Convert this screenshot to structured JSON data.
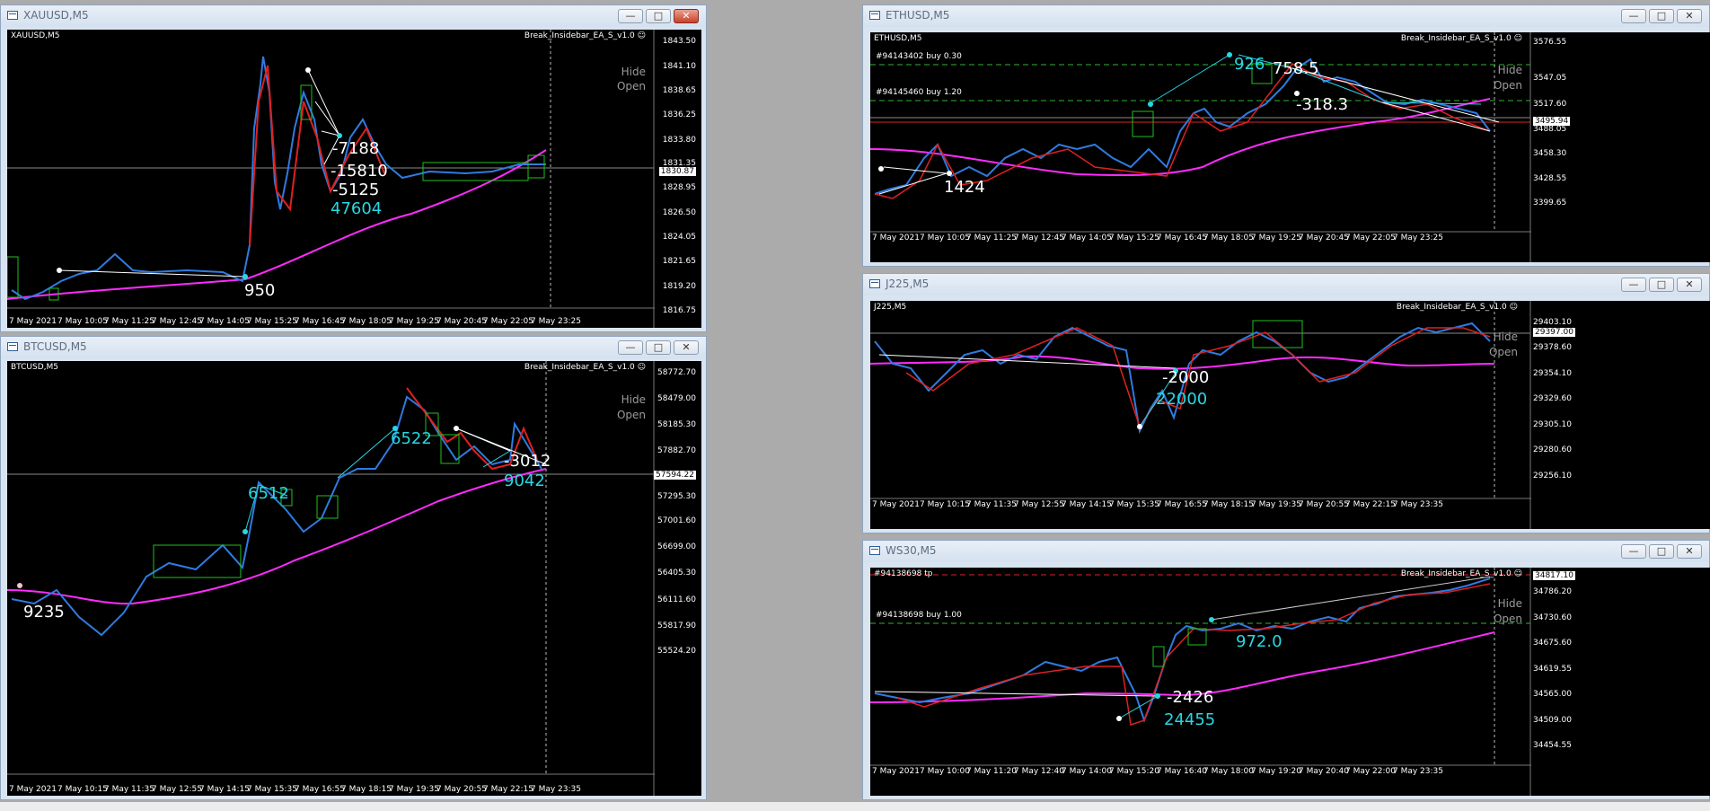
{
  "common": {
    "ea_name": "Break_Insidebar_EA_S_v1.0 ☺",
    "hide_label": "Hide",
    "open_label": "Open"
  },
  "windows": {
    "xau": {
      "title": "XAUUSD,M5",
      "symbol": "XAUUSD,M5",
      "prices": [
        "1843.50",
        "1841.10",
        "1838.65",
        "1836.25",
        "1833.80",
        "1831.35",
        "1830.87",
        "1828.95",
        "1826.50",
        "1824.05",
        "1821.65",
        "1819.20",
        "1816.75"
      ],
      "times": [
        "7 May 2021",
        "7 May 10:05",
        "7 May 11:25",
        "7 May 12:45",
        "7 May 14:05",
        "7 May 15:25",
        "7 May 16:45",
        "7 May 18:05",
        "7 May 19:25",
        "7 May 20:45",
        "7 May 22:05",
        "7 May 23:25"
      ],
      "labels": [
        "-7188",
        "-15810",
        "-5125",
        "47604",
        "950"
      ]
    },
    "btc": {
      "title": "BTCUSD,M5",
      "symbol": "BTCUSD,M5",
      "prices": [
        "58772.70",
        "58479.00",
        "58185.30",
        "57882.70",
        "57594.22",
        "57295.30",
        "57001.60",
        "56699.00",
        "56405.30",
        "56111.60",
        "55817.90",
        "55524.20"
      ],
      "times": [
        "7 May 2021",
        "7 May 10:15",
        "7 May 11:35",
        "7 May 12:55",
        "7 May 14:15",
        "7 May 15:35",
        "7 May 16:55",
        "7 May 18:15",
        "7 May 19:35",
        "7 May 20:55",
        "7 May 22:15",
        "7 May 23:35"
      ],
      "labels": [
        "6522",
        "-3012",
        "9042",
        "6512",
        "9235"
      ]
    },
    "eth": {
      "title": "ETHUSD,M5",
      "symbol": "ETHUSD,M5",
      "orders": [
        "#94143402 buy 0.30",
        "#94145460 buy 1.20"
      ],
      "prices": [
        "3576.55",
        "3547.05",
        "3517.60",
        "3495.94",
        "3488.05",
        "3458.30",
        "3428.55",
        "3399.65"
      ],
      "times": [
        "7 May 2021",
        "7 May 10:05",
        "7 May 11:25",
        "7 May 12:45",
        "7 May 14:05",
        "7 May 15:25",
        "7 May 16:45",
        "7 May 18:05",
        "7 May 19:25",
        "7 May 20:45",
        "7 May 22:05",
        "7 May 23:25"
      ],
      "labels": [
        "926",
        "758.5",
        "-318.3",
        "1424"
      ]
    },
    "j225": {
      "title": "J225,M5",
      "symbol": "J225,M5",
      "prices": [
        "29403.10",
        "29397.00",
        "29378.60",
        "29354.10",
        "29329.60",
        "29305.10",
        "29280.60",
        "29256.10"
      ],
      "times": [
        "7 May 2021",
        "7 May 10:15",
        "7 May 11:35",
        "7 May 12:55",
        "7 May 14:15",
        "7 May 15:35",
        "7 May 16:55",
        "7 May 18:15",
        "7 May 19:35",
        "7 May 20:55",
        "7 May 22:15",
        "7 May 23:35"
      ],
      "labels": [
        "-2000",
        "22000"
      ]
    },
    "ws30": {
      "title": "WS30,M5",
      "symbol": "#94138698 tp",
      "orders": [
        "#94138698 buy 1.00"
      ],
      "prices": [
        "34817.10",
        "34786.20",
        "34730.60",
        "34675.60",
        "34619.55",
        "34565.00",
        "34509.00",
        "34454.55"
      ],
      "times": [
        "7 May 2021",
        "7 May 10:00",
        "7 May 11:20",
        "7 May 12:40",
        "7 May 14:00",
        "7 May 15:20",
        "7 May 16:40",
        "7 May 18:00",
        "7 May 19:20",
        "7 May 20:40",
        "7 May 22:00",
        "7 May 23:35"
      ],
      "labels": [
        "972.0",
        "-2426",
        "24455"
      ]
    }
  }
}
